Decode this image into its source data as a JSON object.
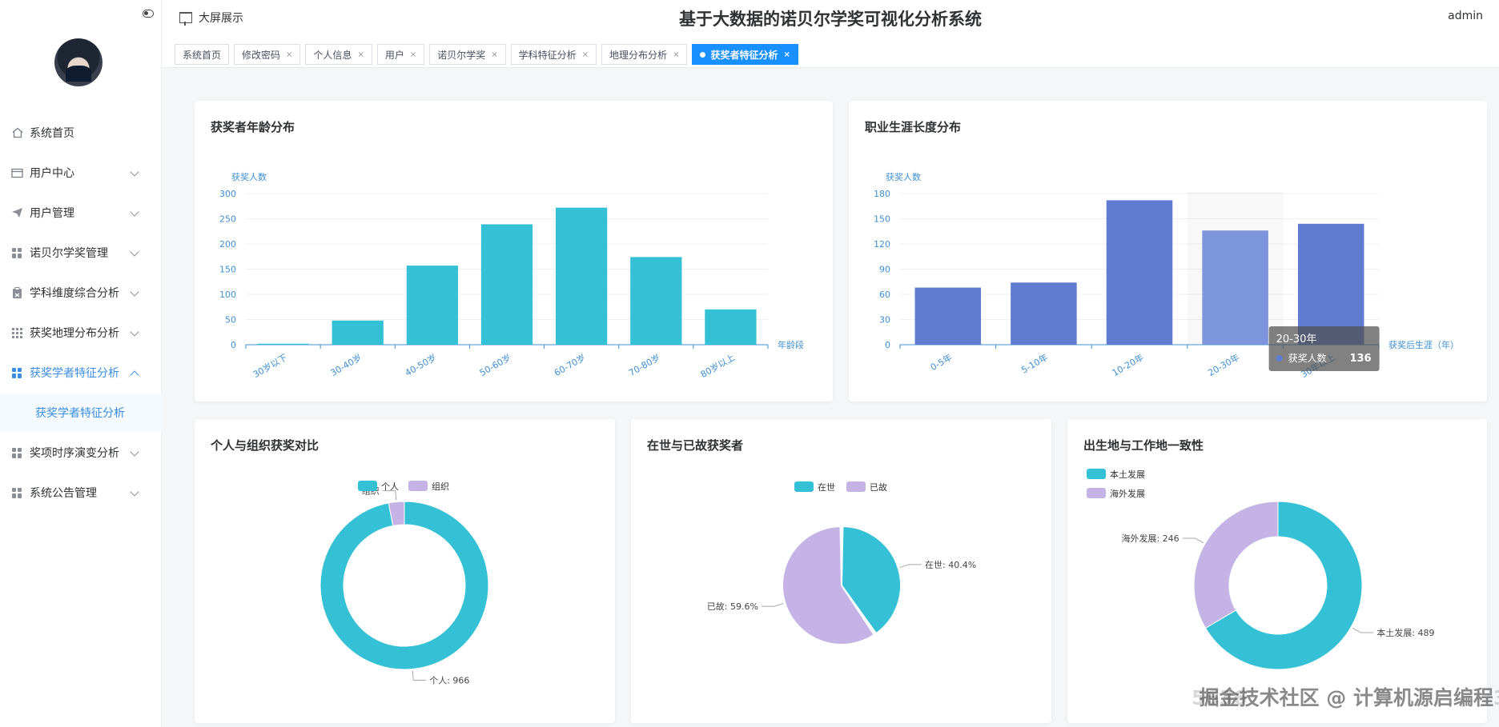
{
  "header": {
    "bigscreen_label": "大屏展示",
    "system_title": "基于大数据的诺贝尔学奖可视化分析系统",
    "user_name": "admin"
  },
  "tabs": [
    {
      "label": "系统首页",
      "closable": false,
      "active": false
    },
    {
      "label": "修改密码",
      "closable": true,
      "active": false
    },
    {
      "label": "个人信息",
      "closable": true,
      "active": false
    },
    {
      "label": "用户",
      "closable": true,
      "active": false
    },
    {
      "label": "诺贝尔学奖",
      "closable": true,
      "active": false
    },
    {
      "label": "学科特征分析",
      "closable": true,
      "active": false
    },
    {
      "label": "地理分布分析",
      "closable": true,
      "active": false
    },
    {
      "label": "获奖者特征分析",
      "closable": true,
      "active": true
    }
  ],
  "tab_close_glyph": "×",
  "sidebar": {
    "items": [
      {
        "label": "系统首页",
        "icon": "home-icon"
      },
      {
        "label": "用户中心",
        "icon": "card-icon"
      },
      {
        "label": "用户管理",
        "icon": "send-icon"
      },
      {
        "label": "诺贝尔学奖管理",
        "icon": "grid-icon"
      },
      {
        "label": "学科维度综合分析",
        "icon": "clipboard-icon"
      },
      {
        "label": "获奖地理分布分析",
        "icon": "grid3-icon"
      },
      {
        "label": "获奖学者特征分析",
        "icon": "grid-icon"
      },
      {
        "label": "奖项时序演变分析",
        "icon": "grid-icon"
      },
      {
        "label": "系统公告管理",
        "icon": "grid-icon"
      }
    ],
    "submenu_label": "获奖学者特征分析"
  },
  "colors": {
    "accent": "#3a8ee6",
    "teal": "#35c1d5",
    "purple": "#c5b3e6",
    "blue_bar": "#5f7cd1",
    "blue_bar_hover": "#7b95df"
  },
  "chart_data": [
    {
      "id": "age",
      "type": "bar",
      "title": "获奖者年龄分布",
      "ylabel": "获奖人数",
      "xlabel": "年龄段",
      "categories": [
        "30岁以下",
        "30-40岁",
        "40-50岁",
        "50-60岁",
        "60-70岁",
        "70-80岁",
        "80岁以上"
      ],
      "values": [
        2,
        48,
        157,
        239,
        272,
        174,
        70
      ],
      "ylim": [
        0,
        300
      ],
      "yticks": [
        0,
        50,
        100,
        150,
        200,
        250,
        300
      ],
      "color": "#35c1d5"
    },
    {
      "id": "career",
      "type": "bar",
      "title": "职业生涯长度分布",
      "ylabel": "获奖人数",
      "xlabel": "获奖后生涯（年）",
      "categories": [
        "0-5年",
        "5-10年",
        "10-20年",
        "20-30年",
        "30年以上"
      ],
      "values": [
        68,
        74,
        172,
        136,
        144
      ],
      "ylim": [
        0,
        180
      ],
      "yticks": [
        0,
        30,
        60,
        90,
        120,
        150,
        180
      ],
      "color": "#5f7cd1",
      "tooltip": {
        "category": "20-30年",
        "series": "获奖人数",
        "value": 136
      }
    },
    {
      "id": "org",
      "type": "pie",
      "title": "个人与组织获奖对比",
      "legend": [
        "个人",
        "组织"
      ],
      "slices": [
        {
          "name": "个人",
          "value": 966,
          "label": "个人: 966",
          "color": "#35c1d5"
        },
        {
          "name": "组织",
          "value": 30,
          "label": "组织",
          "color": "#c5b3e6"
        }
      ]
    },
    {
      "id": "alive",
      "type": "pie",
      "title": "在世与已故获奖者",
      "legend": [
        "在世",
        "已故"
      ],
      "slices": [
        {
          "name": "在世",
          "value": 40.4,
          "label": "在世: 40.4%",
          "color": "#35c1d5"
        },
        {
          "name": "已故",
          "value": 59.6,
          "label": "已故: 59.6%",
          "color": "#c5b3e6"
        }
      ]
    },
    {
      "id": "birth",
      "type": "pie",
      "title": "出生地与工作地一致性",
      "legend": [
        "本土发展",
        "海外发展"
      ],
      "slices": [
        {
          "name": "本土发展",
          "value": 489,
          "label": "本土发展: 489",
          "color": "#35c1d5"
        },
        {
          "name": "海外发展",
          "value": 246,
          "label": "海外发展: 246",
          "color": "#c5b3e6"
        }
      ]
    }
  ],
  "watermark": {
    "text": "掘金技术社区 @ 计算机源启编程",
    "faint_prefix": "5636",
    "faint_suffix": "3"
  }
}
